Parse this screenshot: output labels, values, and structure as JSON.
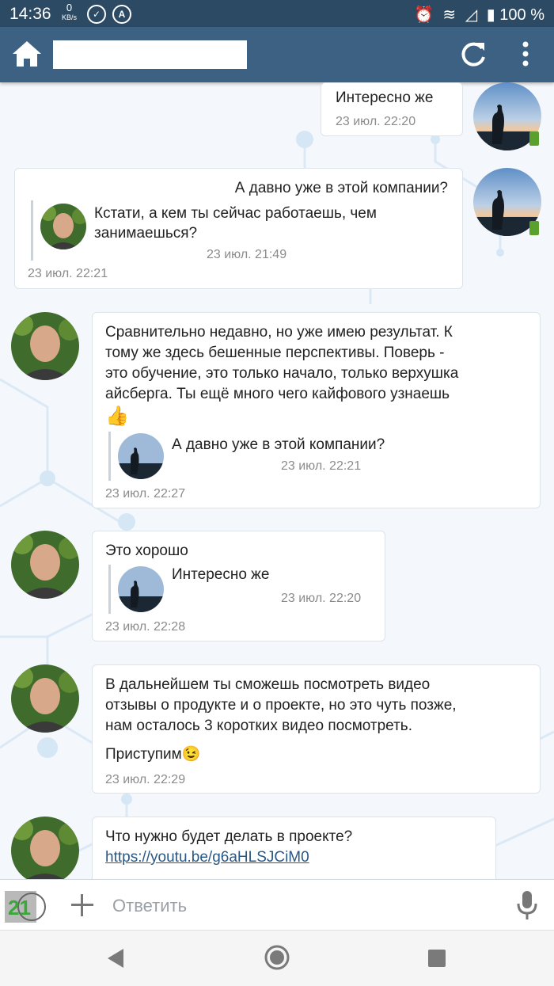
{
  "status_bar": {
    "time": "14:36",
    "speed_value": "0",
    "speed_unit": "KB/s",
    "letter_badge": "A",
    "battery_percent": "100 %"
  },
  "app_bar": {
    "title": ""
  },
  "messages": [
    {
      "text": "Интересно же",
      "time": "23 июл. 22:20"
    },
    {
      "text": "А давно уже в этой компании?",
      "quote_line1": "Кстати, а кем ты сейчас работаешь, чем",
      "quote_line2": "занимаешься?",
      "quote_time": "23 июл. 21:49",
      "time": "23 июл. 22:21"
    },
    {
      "line1": "Сравнительно недавно, но уже имею результат. К",
      "line2": "тому же здесь бешенные перспективы. Поверь -",
      "line3": "это обучение, это только начало, только верхушка",
      "line4": "айсберга. Ты ещё много чего кайфового узнаешь",
      "quote_text": "А давно уже в этой компании?",
      "quote_time": "23 июл. 22:21",
      "time": "23 июл. 22:27"
    },
    {
      "text": "Это хорошо",
      "quote_text": "Интересно же",
      "quote_time": "23 июл. 22:20",
      "time": "23 июл. 22:28"
    },
    {
      "line1": "В дальнейшем ты сможешь посмотреть видео",
      "line2": "отзывы о продукте и о проекте, но это чуть позже,",
      "line3": "нам осталось 3 коротких видео посмотреть.",
      "line4": "Приступим",
      "time": "23 июл. 22:29"
    },
    {
      "text": "Что нужно будет делать в проекте?",
      "link": "https://youtu.be/g6aHLSJCiM0"
    }
  ],
  "compose": {
    "badge": "21",
    "placeholder": "Ответить"
  },
  "colors": {
    "status_bar": "#2c4a64",
    "app_bar": "#3d6182",
    "link": "#2a5885",
    "timestamp": "#8b8b8b"
  },
  "icons": [
    "home-icon",
    "refresh-icon",
    "more-vert-icon",
    "plus-icon",
    "mic-icon",
    "back-icon",
    "home-nav-icon",
    "recents-icon",
    "thumbs-up-emoji",
    "wink-emoji"
  ]
}
